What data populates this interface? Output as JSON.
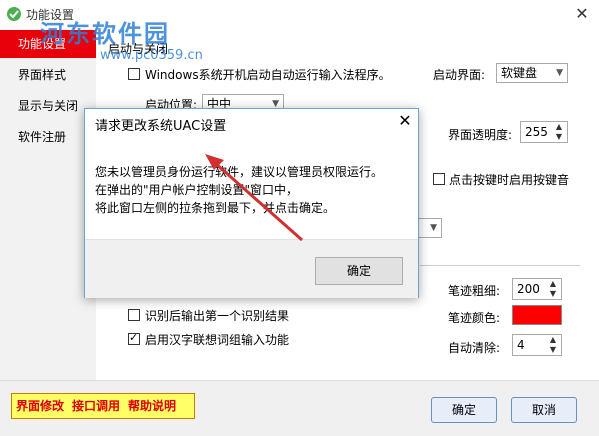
{
  "window": {
    "title": "功能设置",
    "close_glyph": "✕",
    "watermark": "河东软件园",
    "watermark_url": "www.pc0359.cn"
  },
  "sidebar": {
    "items": [
      {
        "label": "功能设置",
        "active": true
      },
      {
        "label": "界面样式"
      },
      {
        "label": "显示与关闭"
      },
      {
        "label": "软件注册"
      }
    ]
  },
  "startup": {
    "group_title": "启动与关闭",
    "autostart_label": "Windows系统开机启动自动运行输入法程序。",
    "autostart_checked": false,
    "start_ui_label": "启动界面:",
    "start_ui_value": "软键盘",
    "start_pos_label": "启动位置:",
    "start_pos_value": "中中",
    "transparency_label": "界面透明度:",
    "transparency_value": "255",
    "key_sound_label": "点击按键时启用按键音",
    "key_sound_checked": false
  },
  "recognition": {
    "output_first_label": "识别后输出第一个识别结果",
    "output_first_checked": false,
    "association_label": "启用汉字联想词组输入功能",
    "association_checked": true,
    "stroke_width_label": "笔迹粗细:",
    "stroke_width_value": "200",
    "stroke_color_label": "笔迹颜色:",
    "stroke_color": "#ff0000",
    "auto_clear_label": "自动清除:",
    "auto_clear_value": "4"
  },
  "footer": {
    "links": [
      "界面修改",
      "接口调用",
      "帮助说明"
    ],
    "ok_label": "确定",
    "cancel_label": "取消"
  },
  "dialog": {
    "title": "请求更改系统UAC设置",
    "close_glyph": "✕",
    "line1": "您未以管理员身份运行软件，建议以管理员权限运行。",
    "line2": "在弹出的\"用户帐户控制设置\"窗口中，",
    "line3": "将此窗口左侧的拉条拖到最下，并点击确定。",
    "ok_label": "确定"
  },
  "colors": {
    "accent_red": "#e8000a",
    "arrow": "#d03030",
    "dialog_border": "#6aa3d6"
  }
}
